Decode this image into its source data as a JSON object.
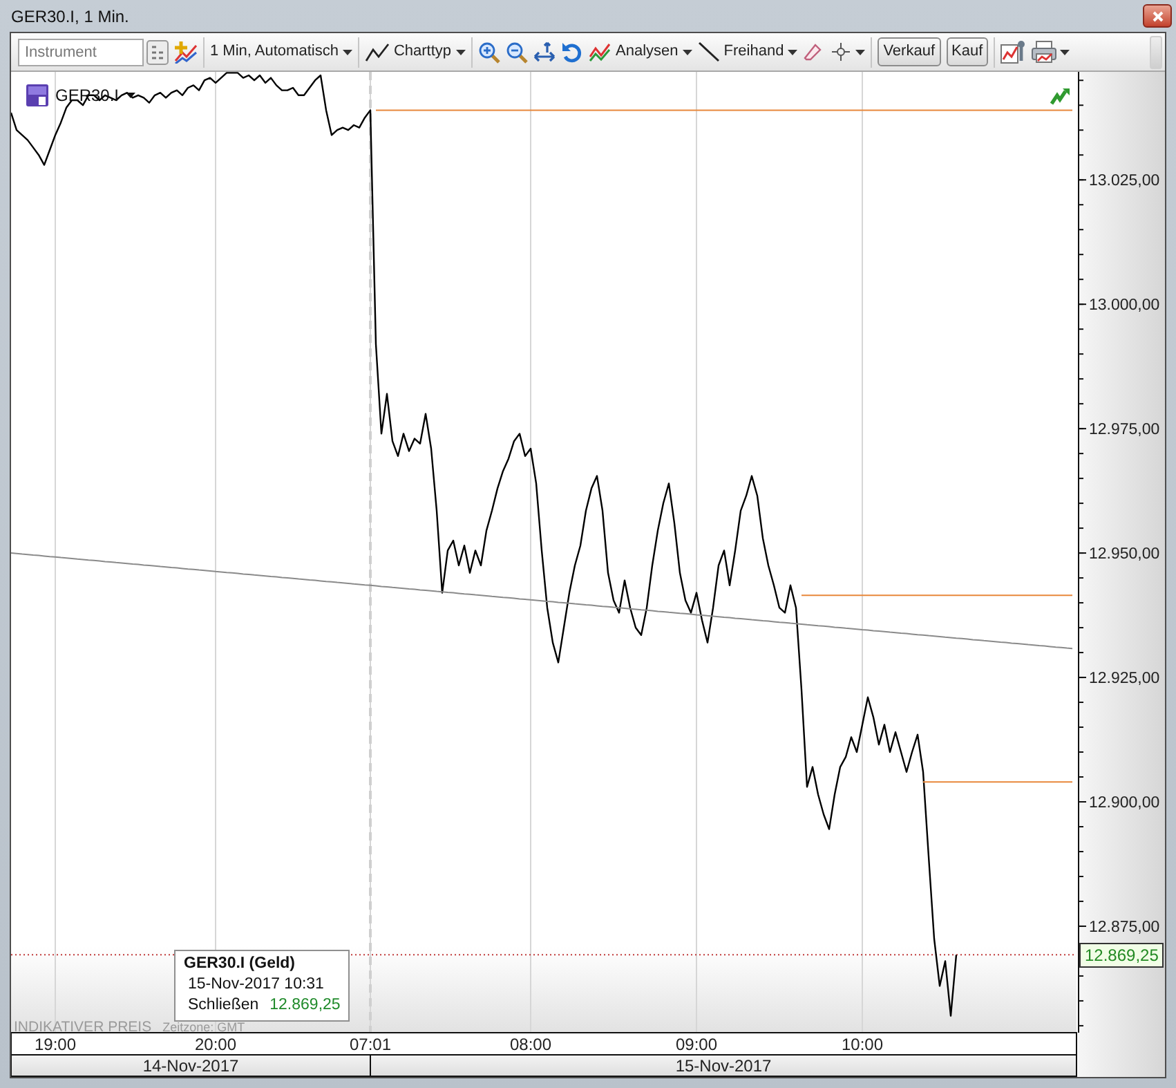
{
  "window": {
    "title": "GER30.I, 1 Min."
  },
  "toolbar": {
    "instrument_field": {
      "placeholder": "Instrument"
    },
    "interval_menu": {
      "label": "1 Min, Automatisch"
    },
    "chart_type_menu": {
      "label": "Charttyp"
    },
    "analyses_menu": {
      "label": "Analysen"
    },
    "freehand_menu": {
      "label": "Freihand"
    },
    "sell_button": {
      "label": "Verkauf"
    },
    "buy_button": {
      "label": "Kauf"
    }
  },
  "chart": {
    "chart_data": {
      "type": "line",
      "categories": [
        null,
        null,
        null,
        null,
        null,
        null,
        null,
        null,
        "19:00",
        null,
        null,
        null,
        null,
        null,
        null,
        null,
        null,
        null,
        null,
        null,
        null,
        null,
        null,
        null,
        null,
        null,
        null,
        null,
        null,
        null,
        null,
        null,
        null,
        null,
        null,
        null,
        null,
        "20:00",
        null,
        null,
        null,
        null,
        null,
        null,
        null,
        null,
        null,
        null,
        null,
        null,
        null,
        null,
        null,
        null,
        null,
        null,
        null,
        null,
        null,
        null,
        null,
        null,
        null,
        null,
        null,
        "07:01",
        null,
        null,
        null,
        null,
        null,
        null,
        null,
        null,
        null,
        null,
        null,
        null,
        null,
        null,
        null,
        null,
        null,
        null,
        null,
        null,
        null,
        null,
        null,
        null,
        null,
        null,
        null,
        null,
        "08:00",
        null,
        null,
        null,
        null,
        null,
        null,
        null,
        null,
        null,
        null,
        null,
        null,
        null,
        null,
        null,
        null,
        null,
        null,
        null,
        null,
        null,
        null,
        null,
        null,
        null,
        null,
        null,
        null,
        null,
        "09:00",
        null,
        null,
        null,
        null,
        null,
        null,
        null,
        null,
        null,
        null,
        null,
        null,
        null,
        null,
        null,
        null,
        null,
        null,
        null,
        null,
        null,
        null,
        null,
        null,
        null,
        null,
        null,
        null,
        null,
        "10:00",
        null,
        null,
        null,
        null,
        null,
        null,
        null,
        null,
        null,
        null,
        null,
        null,
        null,
        null,
        null,
        null,
        null,
        null,
        null,
        null,
        null,
        null,
        null,
        null,
        null,
        null,
        null,
        null,
        null,
        null,
        null,
        null,
        null,
        null,
        null,
        null,
        null,
        null
      ],
      "series": [
        {
          "name": "GER30.I",
          "color": "#000000",
          "values": [
            13038.5,
            13035,
            13034,
            13033,
            13031.5,
            13030,
            13028,
            13031,
            13034,
            13036.5,
            13039.5,
            13041,
            13041,
            13040,
            13042,
            13042,
            13041,
            13042,
            13041.5,
            13041,
            13042,
            13042.5,
            13041.5,
            13042,
            13041.5,
            13040.5,
            13042,
            13042.5,
            13041.5,
            13042.5,
            13043,
            13042,
            13043.5,
            13044,
            13043,
            13045,
            13045.5,
            13044.5,
            13045.5,
            13046.5,
            13046.5,
            13046.5,
            13045.5,
            13046,
            13045,
            13046,
            13044.5,
            13045.5,
            13044,
            13043,
            13043,
            13043.5,
            13042,
            13042,
            13043.5,
            13045,
            13046,
            13039,
            13034,
            13035,
            13035.5,
            13035,
            13036,
            13035.5,
            13037.5,
            13039,
            12992,
            12974,
            12982,
            12972.5,
            12969.5,
            12974,
            12970.5,
            12973,
            12972,
            12978,
            12971,
            12958.5,
            12942,
            12950.5,
            12952.5,
            12947.5,
            12951.5,
            12946,
            12950.5,
            12947.5,
            12954.5,
            12958.5,
            12963,
            12966.5,
            12969,
            12972.5,
            12974,
            12969.5,
            12971,
            12964,
            12950.5,
            12939,
            12932,
            12928,
            12935,
            12942,
            12947.5,
            12951.5,
            12958.5,
            12963,
            12965.5,
            12958.5,
            12946,
            12940.5,
            12938,
            12944.5,
            12939,
            12935,
            12933.5,
            12939,
            12947.5,
            12954.5,
            12960,
            12964,
            12956,
            12946,
            12940.5,
            12938,
            12942,
            12936.5,
            12932,
            12939,
            12947.5,
            12950.5,
            12943.5,
            12950.5,
            12958.5,
            12961.5,
            12965.5,
            12961.5,
            12953,
            12947.5,
            12943.5,
            12939,
            12938,
            12943.5,
            12939,
            12922.5,
            12903,
            12907,
            12901.5,
            12897.5,
            12894.5,
            12901.5,
            12907,
            12909,
            12913,
            12910,
            12915.5,
            12921,
            12917,
            12911.5,
            12915.5,
            12910,
            12914,
            12910,
            12906,
            12910,
            12913.5,
            12906,
            12889,
            12872.5,
            12863,
            12868,
            12857,
            12869.25,
            null,
            null,
            null,
            null,
            null,
            null,
            null,
            null,
            null,
            null,
            null,
            null,
            null,
            null,
            null,
            null,
            null,
            null,
            null,
            null,
            null
          ]
        },
        {
          "color": "#8a8a8a",
          "values": [
            12950,
            12949.9,
            12949.8,
            12949.7,
            12949.6,
            12949.5,
            12949.4,
            12949.3,
            12949.2,
            12949.1,
            12949,
            12948.9,
            12948.8,
            12948.7,
            12948.6,
            12948.5,
            12948.4,
            12948.3,
            12948.2,
            12948.1,
            12948,
            12947.9,
            12947.8,
            12947.7,
            12947.6,
            12947.5,
            12947.4,
            12947.3,
            12947.2,
            12947.1,
            12947,
            12946.9,
            12946.8,
            12946.7,
            12946.6,
            12946.5,
            12946.4,
            12946.3,
            12946.2,
            12946.1,
            12946,
            12945.9,
            12945.8,
            12945.7,
            12945.6,
            12945.5,
            12945.4,
            12945.3,
            12945.2,
            12945.1,
            12945,
            12944.9,
            12944.8,
            12944.7,
            12944.6,
            12944.5,
            12944.4,
            12944.3,
            12944.2,
            12944.1,
            12944,
            12943.9,
            12943.8,
            12943.7,
            12943.6,
            12943.5,
            12943.4,
            12943.3,
            12943.2,
            12943.1,
            12943,
            12942.9,
            12942.8,
            12942.7,
            12942.6,
            12942.5,
            12942.4,
            12942.3,
            12942.2,
            12942.1,
            12942,
            12941.9,
            12941.8,
            12941.7,
            12941.6,
            12941.5,
            12941.4,
            12941.3,
            12941.2,
            12941.1,
            12941,
            12940.9,
            12940.8,
            12940.7,
            12940.6,
            12940.5,
            12940.4,
            12940.3,
            12940.2,
            12940.1,
            12940,
            12939.9,
            12939.8,
            12939.7,
            12939.6,
            12939.5,
            12939.4,
            12939.3,
            12939.2,
            12939.1,
            12939,
            12938.9,
            12938.8,
            12938.7,
            12938.6,
            12938.5,
            12938.4,
            12938.3,
            12938.2,
            12938.1,
            12938,
            12937.9,
            12937.8,
            12937.7,
            12937.6,
            12937.5,
            12937.4,
            12937.3,
            12937.2,
            12937.1,
            12937,
            12936.9,
            12936.8,
            12936.7,
            12936.6,
            12936.5,
            12936.4,
            12936.3,
            12936.2,
            12936.1,
            12936,
            12935.9,
            12935.8,
            12935.7,
            12935.6,
            12935.5,
            12935.4,
            12935.3,
            12935.2,
            12935.1,
            12935,
            12934.9,
            12934.8,
            12934.7,
            12934.6,
            12934.5,
            12934.4,
            12934.3,
            12934.2,
            12934.1,
            12934,
            12933.9,
            12933.8,
            12933.7,
            12933.6,
            12933.5,
            12933.4,
            12933.3,
            12933.2,
            12933.1,
            12933,
            12932.9,
            12932.8,
            12932.7,
            12932.6,
            12932.5,
            12932.4,
            12932.3,
            12932.2,
            12932.1,
            12932,
            12931.9,
            12931.8,
            12931.7,
            12931.6,
            12931.5,
            12931.4,
            12931.3,
            12931.2,
            12931.1,
            12931,
            12930.9,
            12930.8
          ]
        },
        {
          "color": "#e8873a",
          "values": [
            null,
            null,
            null,
            null,
            null,
            null,
            null,
            null,
            null,
            null,
            null,
            null,
            null,
            null,
            null,
            null,
            null,
            null,
            null,
            null,
            null,
            null,
            null,
            null,
            null,
            null,
            null,
            null,
            null,
            null,
            null,
            null,
            null,
            null,
            null,
            null,
            null,
            null,
            null,
            null,
            null,
            null,
            null,
            null,
            null,
            null,
            null,
            null,
            null,
            null,
            null,
            null,
            null,
            null,
            null,
            null,
            null,
            null,
            null,
            null,
            null,
            null,
            null,
            null,
            null,
            null,
            13039,
            13039,
            13039,
            13039,
            13039,
            13039,
            13039,
            13039,
            13039,
            13039,
            13039,
            13039,
            13039,
            13039,
            13039,
            13039,
            13039,
            13039,
            13039,
            13039,
            13039,
            13039,
            13039,
            13039,
            13039,
            13039,
            13039,
            13039,
            13039,
            13039,
            13039,
            13039,
            13039,
            13039,
            13039,
            13039,
            13039,
            13039,
            13039,
            13039,
            13039,
            13039,
            13039,
            13039,
            13039,
            13039,
            13039,
            13039,
            13039,
            13039,
            13039,
            13039,
            13039,
            13039,
            13039,
            13039,
            13039,
            13039,
            13039,
            13039,
            13039,
            13039,
            13039,
            13039,
            13039,
            13039,
            13039,
            13039,
            13039,
            13039,
            13039,
            13039,
            13039,
            13039,
            13039,
            13039,
            13039,
            13039,
            13039,
            13039,
            13039,
            13039,
            13039,
            13039,
            13039,
            13039,
            13039,
            13039,
            13039,
            13039,
            13039,
            13039,
            13039,
            13039,
            13039,
            13039,
            13039,
            13039,
            13039,
            13039,
            13039,
            13039,
            13039,
            13039,
            13039,
            13039,
            13039,
            13039,
            13039,
            13039,
            13039,
            13039,
            13039,
            13039,
            13039,
            13039,
            13039,
            13039,
            13039,
            13039,
            13039,
            13039,
            13039,
            13039,
            13039,
            13039,
            13039
          ]
        },
        {
          "color": "#e8873a",
          "values": [
            null,
            null,
            null,
            null,
            null,
            null,
            null,
            null,
            null,
            null,
            null,
            null,
            null,
            null,
            null,
            null,
            null,
            null,
            null,
            null,
            null,
            null,
            null,
            null,
            null,
            null,
            null,
            null,
            null,
            null,
            null,
            null,
            null,
            null,
            null,
            null,
            null,
            null,
            null,
            null,
            null,
            null,
            null,
            null,
            null,
            null,
            null,
            null,
            null,
            null,
            null,
            null,
            null,
            null,
            null,
            null,
            null,
            null,
            null,
            null,
            null,
            null,
            null,
            null,
            null,
            null,
            null,
            null,
            null,
            null,
            null,
            null,
            null,
            null,
            null,
            null,
            null,
            null,
            null,
            null,
            null,
            null,
            null,
            null,
            null,
            null,
            null,
            null,
            null,
            null,
            null,
            null,
            null,
            null,
            null,
            null,
            null,
            null,
            null,
            null,
            null,
            null,
            null,
            null,
            null,
            null,
            null,
            null,
            null,
            null,
            null,
            null,
            null,
            null,
            null,
            null,
            null,
            null,
            null,
            null,
            null,
            null,
            null,
            null,
            null,
            null,
            null,
            null,
            null,
            null,
            null,
            null,
            null,
            null,
            null,
            null,
            null,
            null,
            null,
            null,
            null,
            null,
            null,
            12941.5,
            12941.5,
            12941.5,
            12941.5,
            12941.5,
            12941.5,
            12941.5,
            12941.5,
            12941.5,
            12941.5,
            12941.5,
            12941.5,
            12941.5,
            12941.5,
            12941.5,
            12941.5,
            12941.5,
            12941.5,
            12941.5,
            12941.5,
            12941.5,
            12941.5,
            12941.5,
            12941.5,
            12941.5,
            12941.5,
            12941.5,
            12941.5,
            12941.5,
            12941.5,
            12941.5,
            12941.5,
            12941.5,
            12941.5,
            12941.5,
            12941.5,
            12941.5,
            12941.5,
            12941.5,
            12941.5,
            12941.5,
            12941.5,
            12941.5,
            12941.5,
            12941.5,
            12941.5,
            12941.5,
            12941.5,
            12941.5,
            12941.5
          ]
        },
        {
          "color": "#e8873a",
          "values": [
            null,
            null,
            null,
            null,
            null,
            null,
            null,
            null,
            null,
            null,
            null,
            null,
            null,
            null,
            null,
            null,
            null,
            null,
            null,
            null,
            null,
            null,
            null,
            null,
            null,
            null,
            null,
            null,
            null,
            null,
            null,
            null,
            null,
            null,
            null,
            null,
            null,
            null,
            null,
            null,
            null,
            null,
            null,
            null,
            null,
            null,
            null,
            null,
            null,
            null,
            null,
            null,
            null,
            null,
            null,
            null,
            null,
            null,
            null,
            null,
            null,
            null,
            null,
            null,
            null,
            null,
            null,
            null,
            null,
            null,
            null,
            null,
            null,
            null,
            null,
            null,
            null,
            null,
            null,
            null,
            null,
            null,
            null,
            null,
            null,
            null,
            null,
            null,
            null,
            null,
            null,
            null,
            null,
            null,
            null,
            null,
            null,
            null,
            null,
            null,
            null,
            null,
            null,
            null,
            null,
            null,
            null,
            null,
            null,
            null,
            null,
            null,
            null,
            null,
            null,
            null,
            null,
            null,
            null,
            null,
            null,
            null,
            null,
            null,
            null,
            null,
            null,
            null,
            null,
            null,
            null,
            null,
            null,
            null,
            null,
            null,
            null,
            null,
            null,
            null,
            null,
            null,
            null,
            null,
            null,
            null,
            null,
            null,
            null,
            null,
            null,
            null,
            null,
            null,
            null,
            null,
            null,
            null,
            null,
            null,
            null,
            null,
            null,
            null,
            null,
            12904,
            12904,
            12904,
            12904,
            12904,
            12904,
            12904,
            12904,
            12904,
            12904,
            12904,
            12904,
            12904,
            12904,
            12904,
            12904,
            12904,
            12904,
            12904,
            12904,
            12904,
            12904,
            12904,
            12904,
            12904,
            12904,
            12904,
            12904
          ]
        }
      ],
      "ylim": [
        12853.6,
        13046.7
      ],
      "yticks": [
        {
          "value": 12875,
          "label": "12.875,00"
        },
        {
          "value": 12900,
          "label": "12.900,00"
        },
        {
          "value": 12925,
          "label": "12.925,00"
        },
        {
          "value": 12950,
          "label": "12.950,00"
        },
        {
          "value": 12975,
          "label": "12.975,00"
        },
        {
          "value": 13000,
          "label": "13.000,00"
        },
        {
          "value": 13025,
          "label": "13.025,00"
        }
      ],
      "ref_lines": [
        {
          "axis": "x",
          "value": "07:01",
          "color": "#cfcfcf"
        },
        {
          "axis": "y",
          "value": 12869.25,
          "color": "#c03a3a"
        }
      ]
    },
    "date_bands": [
      {
        "label": "14-Nov-2017"
      },
      {
        "label": "15-Nov-2017"
      }
    ],
    "tooltip": {
      "title": "GER30.I (Geld)",
      "datetime": "15-Nov-2017 10:31",
      "label": "Schließen",
      "value": "12.869,25"
    },
    "price_label": "12.869,25",
    "footer": {
      "note": "INDIKATIVER PREIS",
      "timezone": "Zeitzone: GMT"
    }
  }
}
